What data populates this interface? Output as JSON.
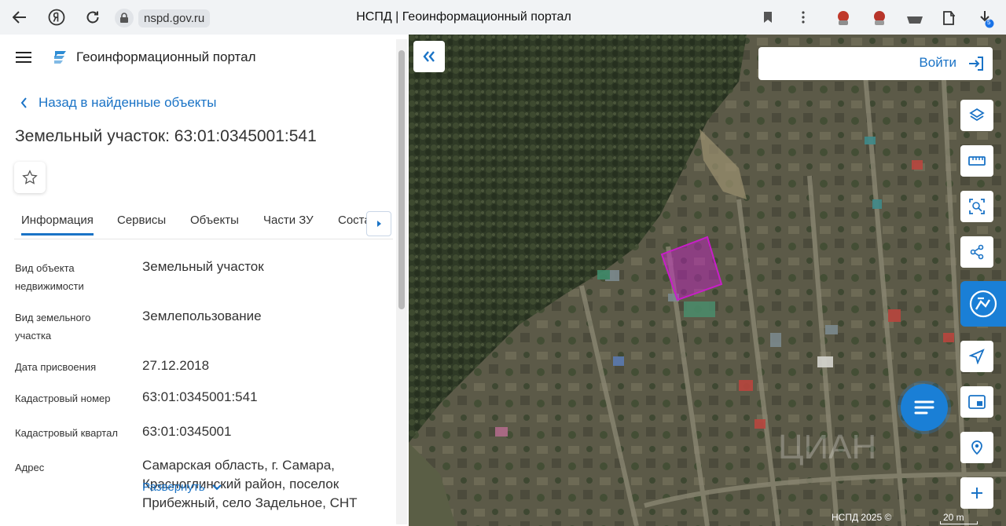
{
  "browser": {
    "domain": "nspd.gov.ru",
    "title": "НСПД | Геоинформационный портал",
    "downloads_badge": "5"
  },
  "header": {
    "app_name": "Геоинформационный портал"
  },
  "back_link": "Назад в найденные объекты",
  "object_title": "Земельный участок: 63:01:0345001:541",
  "tabs": [
    {
      "label": "Информация",
      "active": true
    },
    {
      "label": "Сервисы"
    },
    {
      "label": "Объекты"
    },
    {
      "label": "Части ЗУ"
    },
    {
      "label": "Состав ЕЗ"
    }
  ],
  "info_rows": [
    {
      "label": "Вид объекта недвижимости",
      "value": "Земельный участок"
    },
    {
      "label": "Вид земельного участка",
      "value": "Землепользование"
    },
    {
      "label": "Дата присвоения",
      "value": "27.12.2018"
    },
    {
      "label": "Кадастровый номер",
      "value": "63:01:0345001:541"
    },
    {
      "label": "Кадастровый квартал",
      "value": "63:01:0345001"
    },
    {
      "label": "Адрес",
      "value": "Самарская область, г. Самара, Красноглинский район, поселок Прибежный, село Задельное, СНТ"
    }
  ],
  "expand_label": "Развернуть",
  "map": {
    "login_label": "Войти",
    "copyright": "НСПД 2025 ©",
    "scale_label": "20 m",
    "accent": "#1a7fd6",
    "parcel_color": "#c81ec8"
  }
}
